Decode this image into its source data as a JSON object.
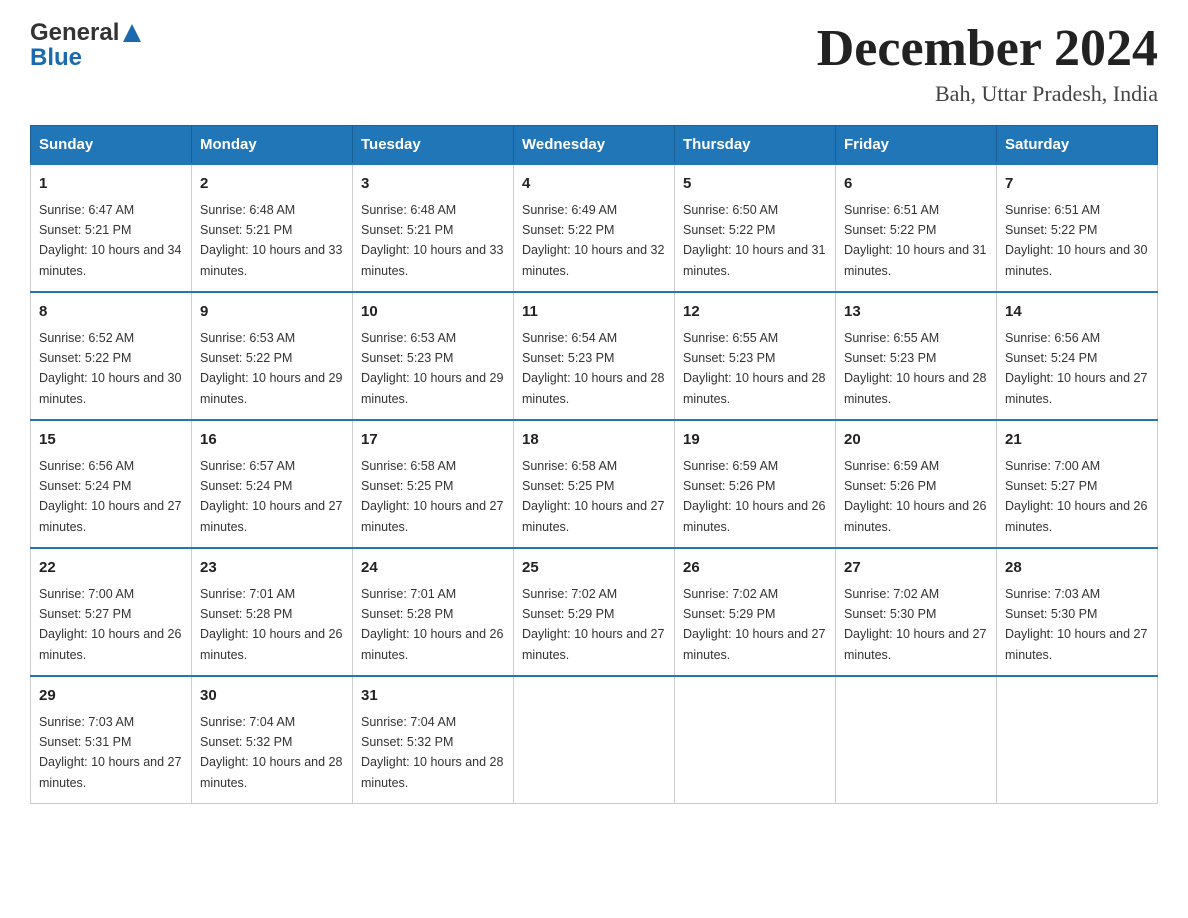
{
  "header": {
    "logo": {
      "general": "General",
      "blue": "Blue"
    },
    "title": "December 2024",
    "subtitle": "Bah, Uttar Pradesh, India"
  },
  "columns": [
    "Sunday",
    "Monday",
    "Tuesday",
    "Wednesday",
    "Thursday",
    "Friday",
    "Saturday"
  ],
  "weeks": [
    [
      {
        "day": "1",
        "sunrise": "6:47 AM",
        "sunset": "5:21 PM",
        "daylight": "10 hours and 34 minutes."
      },
      {
        "day": "2",
        "sunrise": "6:48 AM",
        "sunset": "5:21 PM",
        "daylight": "10 hours and 33 minutes."
      },
      {
        "day": "3",
        "sunrise": "6:48 AM",
        "sunset": "5:21 PM",
        "daylight": "10 hours and 33 minutes."
      },
      {
        "day": "4",
        "sunrise": "6:49 AM",
        "sunset": "5:22 PM",
        "daylight": "10 hours and 32 minutes."
      },
      {
        "day": "5",
        "sunrise": "6:50 AM",
        "sunset": "5:22 PM",
        "daylight": "10 hours and 31 minutes."
      },
      {
        "day": "6",
        "sunrise": "6:51 AM",
        "sunset": "5:22 PM",
        "daylight": "10 hours and 31 minutes."
      },
      {
        "day": "7",
        "sunrise": "6:51 AM",
        "sunset": "5:22 PM",
        "daylight": "10 hours and 30 minutes."
      }
    ],
    [
      {
        "day": "8",
        "sunrise": "6:52 AM",
        "sunset": "5:22 PM",
        "daylight": "10 hours and 30 minutes."
      },
      {
        "day": "9",
        "sunrise": "6:53 AM",
        "sunset": "5:22 PM",
        "daylight": "10 hours and 29 minutes."
      },
      {
        "day": "10",
        "sunrise": "6:53 AM",
        "sunset": "5:23 PM",
        "daylight": "10 hours and 29 minutes."
      },
      {
        "day": "11",
        "sunrise": "6:54 AM",
        "sunset": "5:23 PM",
        "daylight": "10 hours and 28 minutes."
      },
      {
        "day": "12",
        "sunrise": "6:55 AM",
        "sunset": "5:23 PM",
        "daylight": "10 hours and 28 minutes."
      },
      {
        "day": "13",
        "sunrise": "6:55 AM",
        "sunset": "5:23 PM",
        "daylight": "10 hours and 28 minutes."
      },
      {
        "day": "14",
        "sunrise": "6:56 AM",
        "sunset": "5:24 PM",
        "daylight": "10 hours and 27 minutes."
      }
    ],
    [
      {
        "day": "15",
        "sunrise": "6:56 AM",
        "sunset": "5:24 PM",
        "daylight": "10 hours and 27 minutes."
      },
      {
        "day": "16",
        "sunrise": "6:57 AM",
        "sunset": "5:24 PM",
        "daylight": "10 hours and 27 minutes."
      },
      {
        "day": "17",
        "sunrise": "6:58 AM",
        "sunset": "5:25 PM",
        "daylight": "10 hours and 27 minutes."
      },
      {
        "day": "18",
        "sunrise": "6:58 AM",
        "sunset": "5:25 PM",
        "daylight": "10 hours and 27 minutes."
      },
      {
        "day": "19",
        "sunrise": "6:59 AM",
        "sunset": "5:26 PM",
        "daylight": "10 hours and 26 minutes."
      },
      {
        "day": "20",
        "sunrise": "6:59 AM",
        "sunset": "5:26 PM",
        "daylight": "10 hours and 26 minutes."
      },
      {
        "day": "21",
        "sunrise": "7:00 AM",
        "sunset": "5:27 PM",
        "daylight": "10 hours and 26 minutes."
      }
    ],
    [
      {
        "day": "22",
        "sunrise": "7:00 AM",
        "sunset": "5:27 PM",
        "daylight": "10 hours and 26 minutes."
      },
      {
        "day": "23",
        "sunrise": "7:01 AM",
        "sunset": "5:28 PM",
        "daylight": "10 hours and 26 minutes."
      },
      {
        "day": "24",
        "sunrise": "7:01 AM",
        "sunset": "5:28 PM",
        "daylight": "10 hours and 26 minutes."
      },
      {
        "day": "25",
        "sunrise": "7:02 AM",
        "sunset": "5:29 PM",
        "daylight": "10 hours and 27 minutes."
      },
      {
        "day": "26",
        "sunrise": "7:02 AM",
        "sunset": "5:29 PM",
        "daylight": "10 hours and 27 minutes."
      },
      {
        "day": "27",
        "sunrise": "7:02 AM",
        "sunset": "5:30 PM",
        "daylight": "10 hours and 27 minutes."
      },
      {
        "day": "28",
        "sunrise": "7:03 AM",
        "sunset": "5:30 PM",
        "daylight": "10 hours and 27 minutes."
      }
    ],
    [
      {
        "day": "29",
        "sunrise": "7:03 AM",
        "sunset": "5:31 PM",
        "daylight": "10 hours and 27 minutes."
      },
      {
        "day": "30",
        "sunrise": "7:04 AM",
        "sunset": "5:32 PM",
        "daylight": "10 hours and 28 minutes."
      },
      {
        "day": "31",
        "sunrise": "7:04 AM",
        "sunset": "5:32 PM",
        "daylight": "10 hours and 28 minutes."
      },
      null,
      null,
      null,
      null
    ]
  ]
}
